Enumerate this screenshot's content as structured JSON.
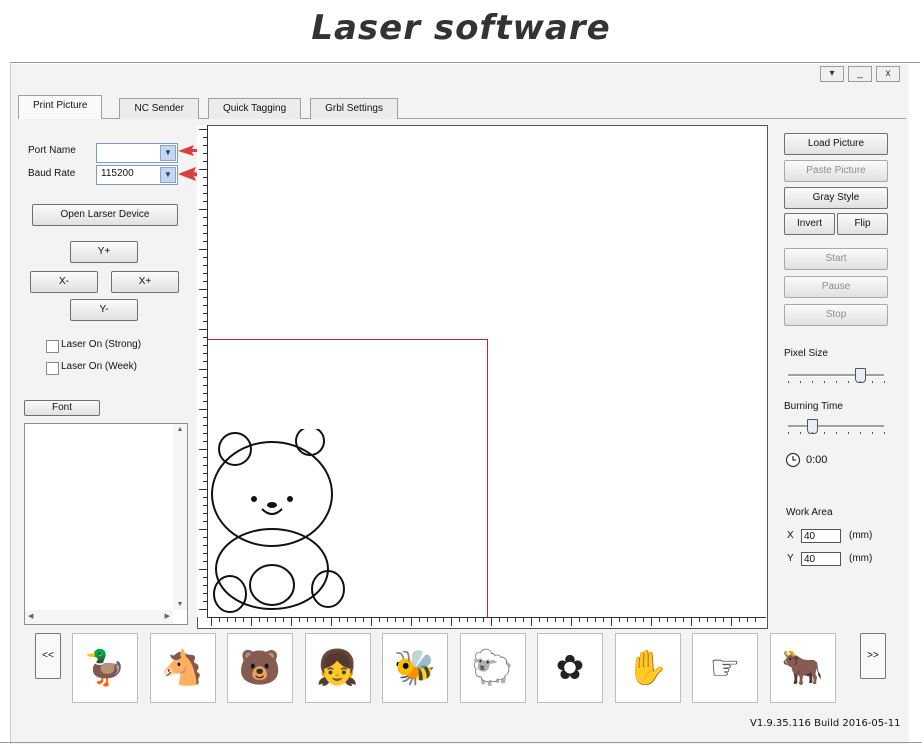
{
  "heading": "Laser software",
  "window": {
    "minimize_label": "_",
    "close_label": "x",
    "menu_label": "▾"
  },
  "tabs": [
    "Print Picture",
    "NC Sender",
    "Quick Tagging",
    "Grbl Settings"
  ],
  "left": {
    "port_name_label": "Port Name",
    "port_name_value": "",
    "baud_rate_label": "Baud Rate",
    "baud_rate_value": "115200",
    "open_device_label": "Open Larser Device",
    "jog": {
      "y_plus": "Y+",
      "x_minus": "X-",
      "x_plus": "X+",
      "y_minus": "Y-"
    },
    "laser_strong_label": "Laser On (Strong)",
    "laser_week_label": "Laser On (Week)",
    "font_button_label": "Font"
  },
  "right": {
    "load_picture": "Load Picture",
    "paste_picture": "Paste Picture",
    "gray_style": "Gray Style",
    "invert": "Invert",
    "flip": "Flip",
    "start": "Start",
    "pause": "Pause",
    "stop": "Stop",
    "pixel_size_label": "Pixel Size",
    "pixel_size_level": 0.75,
    "burning_time_label": "Burning Time",
    "burning_time_level": 0.25,
    "timer_text": "0:00",
    "work_area_label": "Work Area",
    "x_label": "X",
    "x_value": "40",
    "y_label": "Y",
    "y_value": "40",
    "unit": "(mm)"
  },
  "gallery": {
    "prev_label": "<<",
    "next_label": ">>",
    "items": [
      "duck-icon",
      "pony-icon",
      "bear-icon",
      "girl-icon",
      "bee-icon",
      "sheep-icon",
      "flower-icon",
      "middle-finger-icon",
      "pointing-hand-icon",
      "bull-icon"
    ]
  },
  "version": "V1.9.35.116 Build 2016-05-11",
  "colors": {
    "accent_red": "#d94040",
    "selection_red": "#cc2222"
  }
}
